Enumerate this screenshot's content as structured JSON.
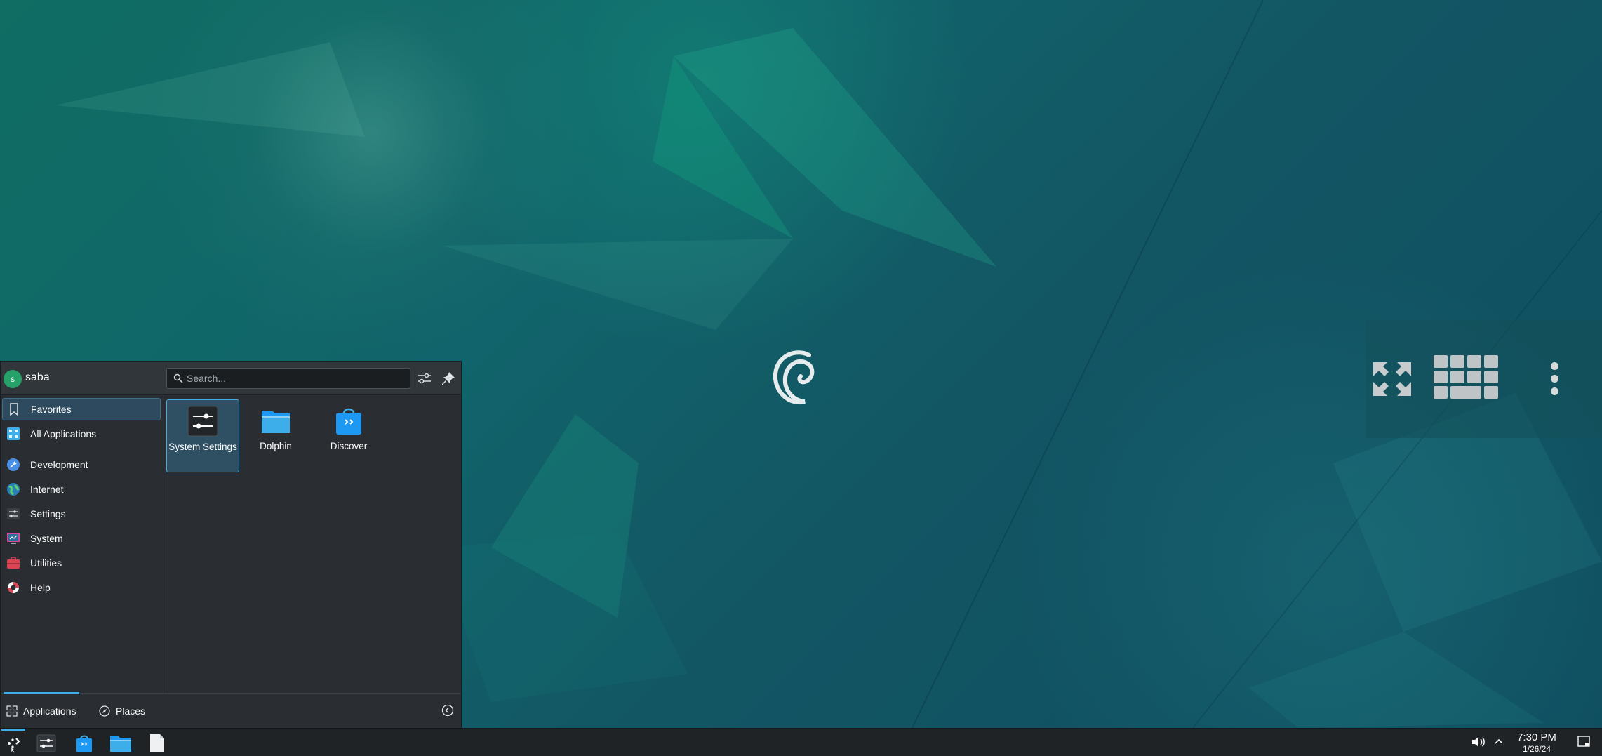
{
  "user": {
    "name": "saba",
    "initial": "s"
  },
  "search": {
    "placeholder": "Search..."
  },
  "sidebar": {
    "items": [
      {
        "label": "Favorites",
        "icon": "bookmark-icon",
        "selected": true
      },
      {
        "label": "All Applications",
        "icon": "applications-icon"
      },
      {
        "label": "Development",
        "icon": "development-icon"
      },
      {
        "label": "Internet",
        "icon": "globe-icon"
      },
      {
        "label": "Settings",
        "icon": "settings-icon"
      },
      {
        "label": "System",
        "icon": "system-icon"
      },
      {
        "label": "Utilities",
        "icon": "utilities-icon"
      },
      {
        "label": "Help",
        "icon": "help-lifebuoy-icon"
      }
    ]
  },
  "favorites": [
    {
      "label": "System Settings",
      "icon": "system-settings-icon",
      "selected": true
    },
    {
      "label": "Dolphin",
      "icon": "folder-icon"
    },
    {
      "label": "Discover",
      "icon": "discover-bag-icon"
    }
  ],
  "footer": {
    "applications_tab": "Applications",
    "places_tab": "Places"
  },
  "panel": {
    "clock_time": "7:30 PM",
    "clock_date": "1/26/24"
  },
  "colors": {
    "accent": "#3daee9",
    "menu_bg": "#2a2e32",
    "panel_bg": "#202326",
    "selection_bg": "#2d4a5e"
  }
}
